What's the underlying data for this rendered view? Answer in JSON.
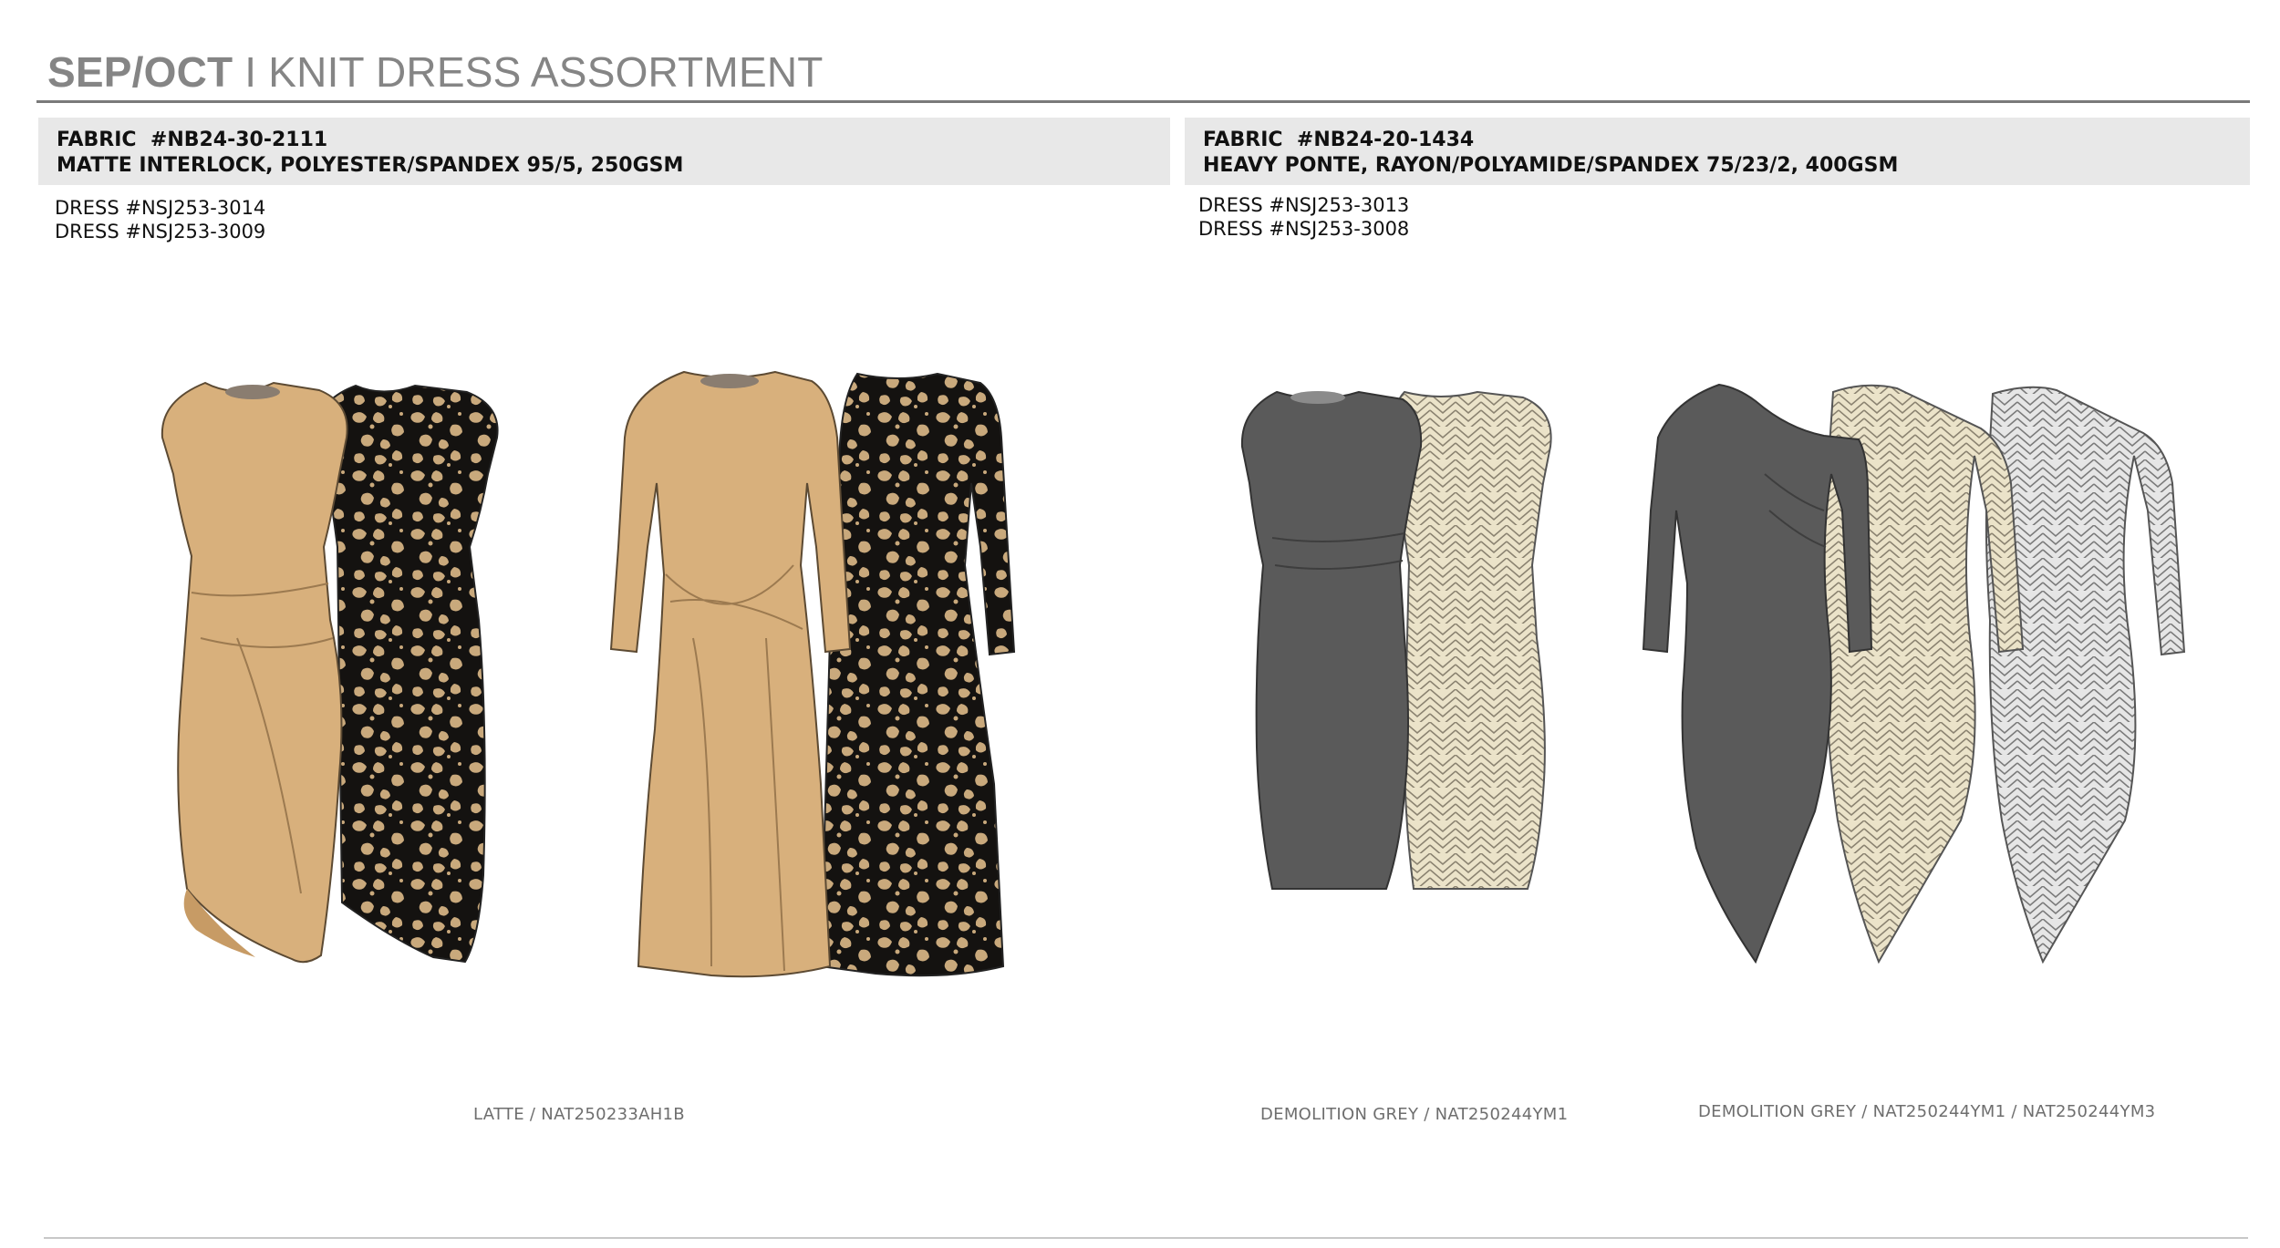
{
  "page": {
    "title_bold": "SEP/OCT",
    "title_rest": " I KNIT DRESS ASSORTMENT"
  },
  "panels": [
    {
      "fabric_line": "FABRIC  #NB24-30-2111",
      "composition": "MATTE INTERLOCK, POLYESTER/SPANDEX 95/5, 250GSM",
      "dresses": [
        "DRESS #NSJ253-3014",
        "DRESS #NSJ253-3009"
      ]
    },
    {
      "fabric_line": "FABRIC  #NB24-20-1434",
      "composition": "HEAVY PONTE, RAYON/POLYAMIDE/SPANDEX 75/23/2, 400GSM",
      "dresses": [
        "DRESS #NSJ253-3013",
        "DRESS #NSJ253-3008"
      ]
    }
  ],
  "captions": [
    "LATTE / NAT250233AH1B",
    "DEMOLITION GREY / NAT250244YM1",
    "DEMOLITION GREY / NAT250244YM1 / NAT250244YM3"
  ],
  "colors": {
    "latte": "#d8b07c",
    "latte_shade": "#c79b65",
    "leopard_base": "#141210",
    "leopard_spot": "#c9a97c",
    "demolition_grey": "#5a5a5a",
    "chevron_light": "#ebe3c9",
    "chevron_grey": "#e6e6e6"
  }
}
